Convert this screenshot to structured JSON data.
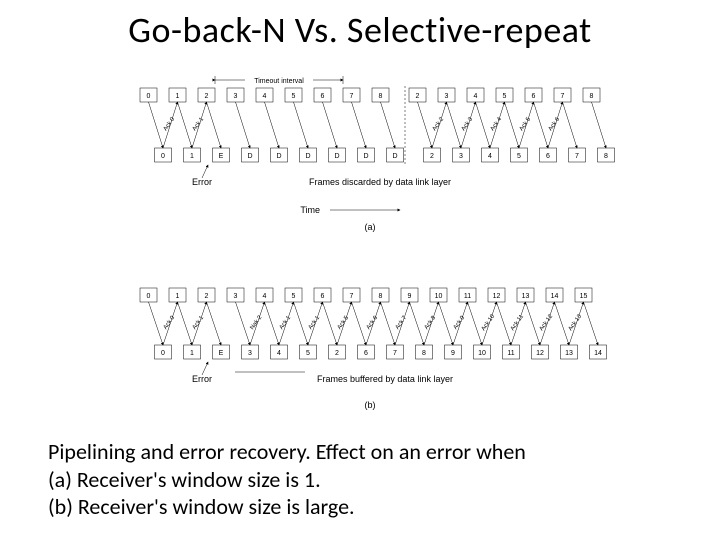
{
  "title": "Go-back-N   Vs.  Selective-repeat",
  "caption_line1": "Pipelining and error recovery.  Effect on an error when",
  "caption_line2": "(a) Receiver's window size is 1.",
  "caption_line3": "(b) Receiver's window size is large.",
  "diagram_a": {
    "label": "(a)",
    "time_label": "Time",
    "timeout_label": "Timeout interval",
    "sender_seq": [
      "0",
      "1",
      "2",
      "3",
      "4",
      "5",
      "6",
      "7",
      "8",
      "2",
      "3",
      "4",
      "5",
      "6",
      "7",
      "8"
    ],
    "receiver_seq": [
      "0",
      "1",
      "E",
      "D",
      "D",
      "D",
      "D",
      "D",
      "D",
      "2",
      "3",
      "4",
      "5",
      "6",
      "7",
      "8"
    ],
    "error_label": "Error",
    "discard_label": "Frames discarded by data link layer",
    "acks": [
      "Ack 0",
      "Ack 1",
      "Ack 2",
      "Ack 3",
      "Ack 4",
      "Ack 5",
      "Ack 6"
    ]
  },
  "diagram_b": {
    "label": "(b)",
    "sender_seq": [
      "0",
      "1",
      "2",
      "3",
      "4",
      "5",
      "6",
      "7",
      "8",
      "9",
      "10",
      "11",
      "12",
      "13",
      "14",
      "15"
    ],
    "receiver_seq": [
      "0",
      "1",
      "E",
      "3",
      "4",
      "5",
      "2",
      "6",
      "7",
      "8",
      "9",
      "10",
      "11",
      "12",
      "13",
      "14"
    ],
    "error_label": "Error",
    "buffer_label": "Frames buffered by data link layer",
    "acks_and_nak": [
      "Ack 0",
      "Ack 1",
      "Nak 2",
      "Ack 1",
      "Ack 1",
      "Ack 5",
      "Ack 6",
      "Ack 7",
      "Ack 8",
      "Ack 9",
      "Ack 10",
      "Ack 11",
      "Ack 12",
      "Ack 13"
    ]
  }
}
